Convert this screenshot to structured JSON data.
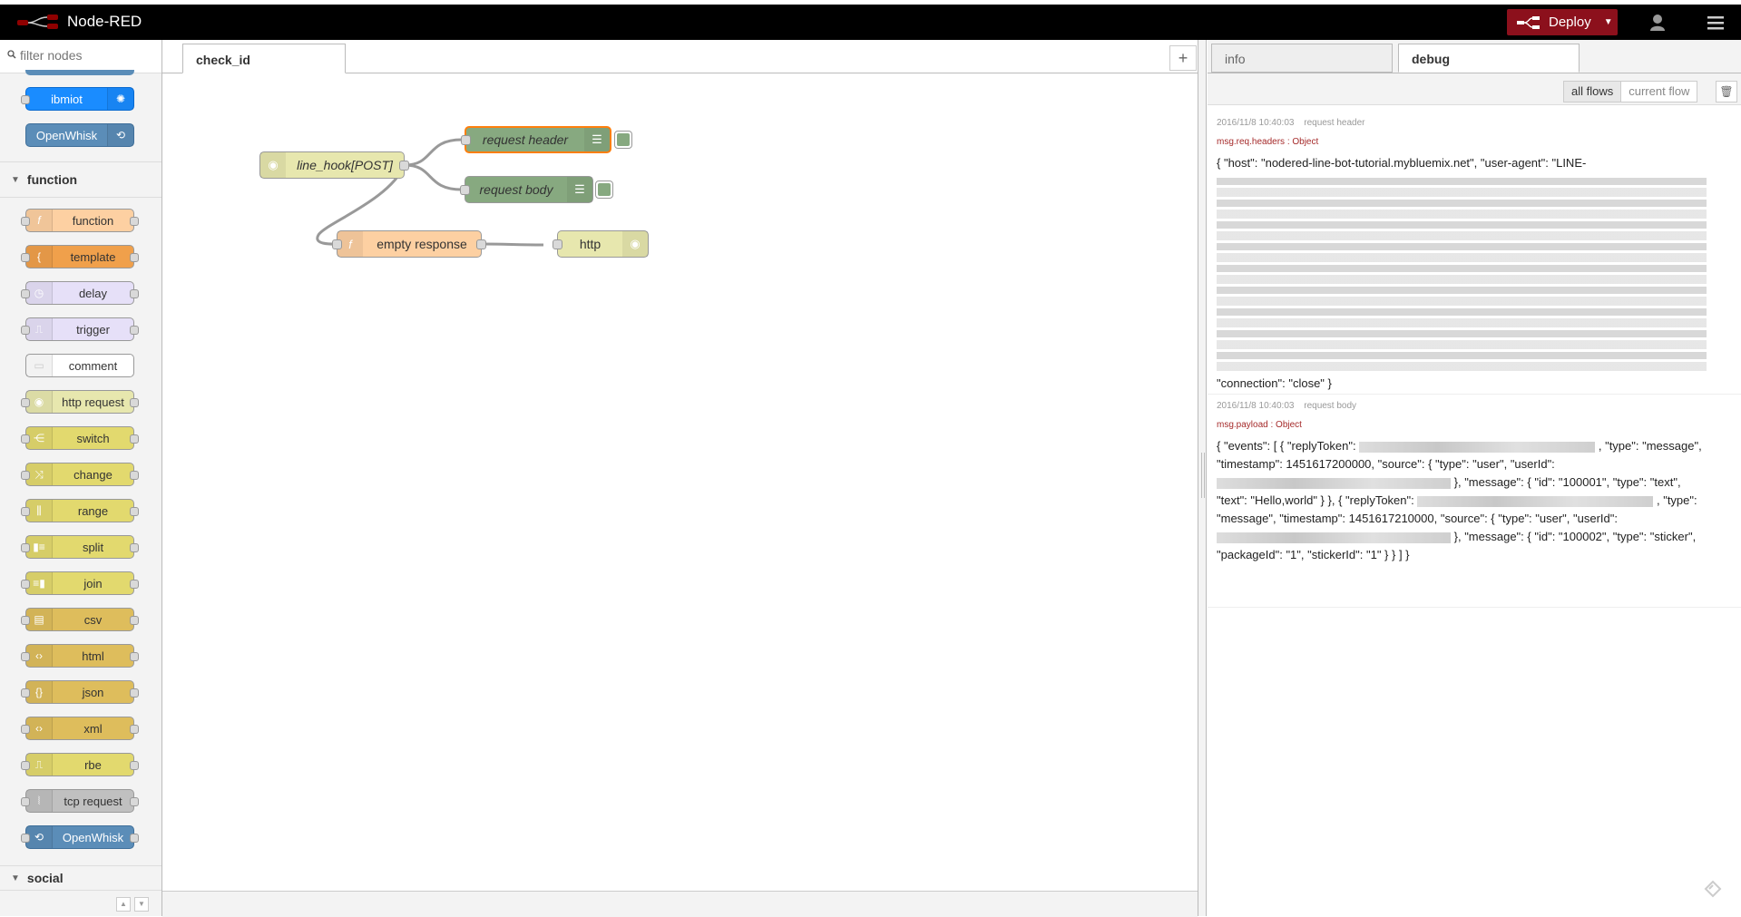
{
  "app": {
    "title": "Node-RED"
  },
  "header": {
    "deploy_label": "Deploy"
  },
  "palette": {
    "filter_placeholder": "filter nodes",
    "top_nodes": [
      {
        "label": "ibmiot",
        "color": "#1a8cff"
      },
      {
        "label": "OpenWhisk",
        "color": "#5b8db8"
      }
    ],
    "categories": {
      "function": "function",
      "social": "social"
    },
    "function_nodes": [
      {
        "label": "function",
        "color": "#fdd0a2"
      },
      {
        "label": "template",
        "color": "#f0a04b"
      },
      {
        "label": "delay",
        "color": "#e6e0f8"
      },
      {
        "label": "trigger",
        "color": "#e6e0f8"
      },
      {
        "label": "comment",
        "color": "#ffffff"
      },
      {
        "label": "http request",
        "color": "#e7e7ae"
      },
      {
        "label": "switch",
        "color": "#e2d96e"
      },
      {
        "label": "change",
        "color": "#e2d96e"
      },
      {
        "label": "range",
        "color": "#e2d96e"
      },
      {
        "label": "split",
        "color": "#e2d96e"
      },
      {
        "label": "join",
        "color": "#e2d96e"
      },
      {
        "label": "csv",
        "color": "#debd5c"
      },
      {
        "label": "html",
        "color": "#debd5c"
      },
      {
        "label": "json",
        "color": "#debd5c"
      },
      {
        "label": "xml",
        "color": "#debd5c"
      },
      {
        "label": "rbe",
        "color": "#e2d96e"
      },
      {
        "label": "tcp request",
        "color": "#c0c0c0"
      },
      {
        "label": "OpenWhisk",
        "color": "#5b8db8"
      }
    ]
  },
  "workspace": {
    "tab_label": "check_id",
    "nodes": {
      "line_hook": "line_hook[POST]",
      "request_header": "request header",
      "request_body": "request body",
      "empty_response": "empty response",
      "http": "http"
    }
  },
  "sidebar": {
    "tabs": {
      "info": "info",
      "debug": "debug"
    },
    "filter_all": "all flows",
    "filter_current": "current flow",
    "messages": [
      {
        "timestamp": "2016/11/8 10:40:03",
        "node": "request header",
        "topic": "msg.req.headers : Object",
        "payload_start": "{ \"host\": \"nodered-line-bot-tutorial.mybluemix.net\", \"user-agent\": \"LINE-",
        "payload_end": "\"connection\": \"close\" }"
      },
      {
        "timestamp": "2016/11/8 10:40:03",
        "node": "request body",
        "topic": "msg.payload : Object",
        "p1": "{ \"events\": [ { \"replyToken\":",
        "p2": ", \"type\": \"message\",",
        "p3": "\"timestamp\": 1451617200000, \"source\": { \"type\": \"user\", \"userId\":",
        "p4": "}, \"message\": { \"id\": \"100001\", \"type\": \"text\",",
        "p5": "\"text\": \"Hello,world\" } }, { \"replyToken\":",
        "p6": ", \"type\":",
        "p7": "\"message\", \"timestamp\": 1451617210000, \"source\": { \"type\": \"user\", \"userId\":",
        "p8": "}, \"message\": { \"id\": \"100002\", \"type\": \"sticker\",",
        "p9": "\"packageId\": \"1\", \"stickerId\": \"1\" } } ] }"
      }
    ]
  }
}
